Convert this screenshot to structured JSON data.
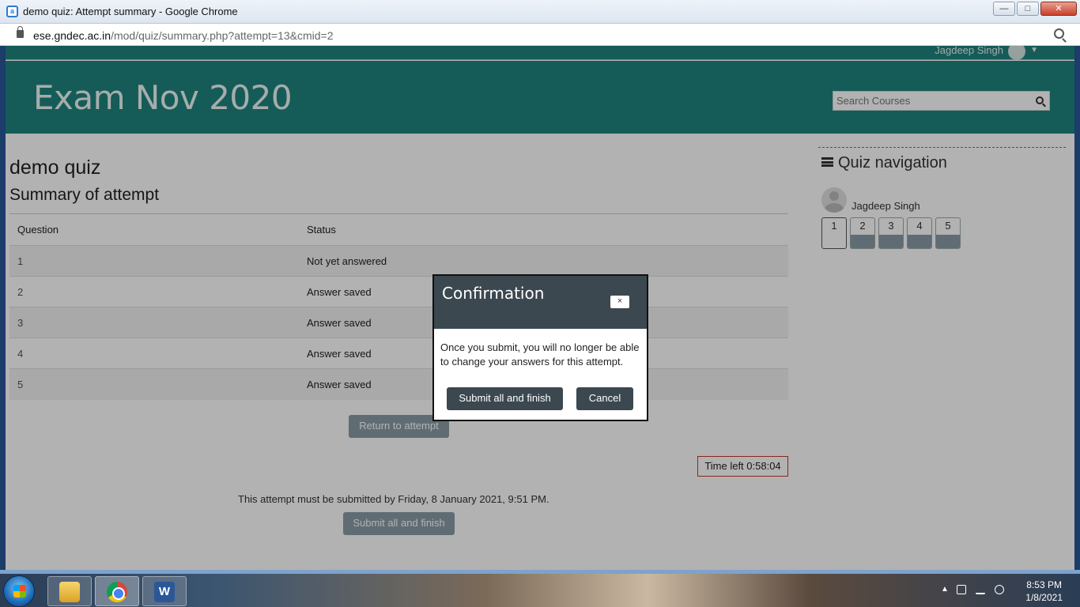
{
  "window": {
    "title": "demo quiz: Attempt summary - Google Chrome",
    "controls": {
      "minimize": "—",
      "maximize": "□",
      "close": "✕"
    }
  },
  "address": {
    "host": "ese.gndec.ac.in",
    "path": "/mod/quiz/summary.php?attempt=13&cmid=2"
  },
  "topbar": {
    "user_name": "Jagdeep Singh"
  },
  "header": {
    "site_title": "Exam Nov 2020",
    "search_placeholder": "Search Courses"
  },
  "main": {
    "quiz_title": "demo quiz",
    "summary_title": "Summary of attempt",
    "table": {
      "headers": [
        "Question",
        "Status"
      ],
      "rows": [
        {
          "question": "1",
          "status": "Not yet answered"
        },
        {
          "question": "2",
          "status": "Answer saved"
        },
        {
          "question": "3",
          "status": "Answer saved"
        },
        {
          "question": "4",
          "status": "Answer saved"
        },
        {
          "question": "5",
          "status": "Answer saved"
        }
      ]
    },
    "return_label": "Return to attempt",
    "timer_label": "Time left 0:58:04",
    "deadline_text": "This attempt must be submitted by Friday, 8 January 2021, 9:51 PM.",
    "submit_label": "Submit all and finish"
  },
  "quiz_nav": {
    "title": "Quiz navigation",
    "user_name": "Jagdeep Singh",
    "questions": [
      "1",
      "2",
      "3",
      "4",
      "5"
    ]
  },
  "modal": {
    "title": "Confirmation",
    "close_label": "×",
    "body": "Once you submit, you will no longer be able to change your answers for this attempt.",
    "submit_label": "Submit all and finish",
    "cancel_label": "Cancel"
  },
  "taskbar": {
    "word_glyph": "W",
    "clock_time": "8:53 PM",
    "clock_date": "1/8/2021"
  },
  "colors": {
    "brand_teal": "#1f857f",
    "button_gray": "#8a9ba6",
    "modal_dark": "#3b4850",
    "timer_border": "#c0392b"
  }
}
